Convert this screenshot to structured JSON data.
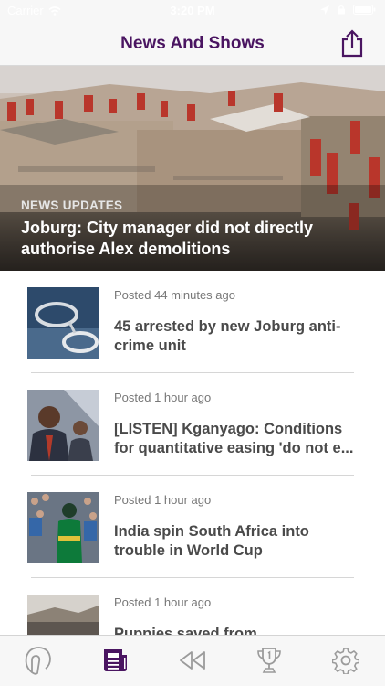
{
  "status_bar": {
    "carrier": "Carrier",
    "time": "3:20 PM"
  },
  "navbar": {
    "title": "News And Shows",
    "share_icon": "share-icon"
  },
  "hero": {
    "category": "NEWS UPDATES",
    "title": "Joburg: City manager did not directly authorise Alex demolitions"
  },
  "articles": [
    {
      "time": "Posted 44 minutes ago",
      "title_line1": "45 arrested by new Joburg anti-",
      "title_line2": "crime unit"
    },
    {
      "time": "Posted 1 hour ago",
      "title_line1": "[LISTEN] Kganyago: Conditions",
      "title_line2": "for quantitative easing 'do not e..."
    },
    {
      "time": "Posted 1 hour ago",
      "title_line1": "India spin South Africa into",
      "title_line2": "trouble in World Cup"
    },
    {
      "time": "Posted 1 hour ago",
      "title_line1": "Puppies saved from",
      "title_line2": ""
    }
  ],
  "tabbar": {
    "tabs": [
      {
        "icon": "listen-icon",
        "active": false
      },
      {
        "icon": "news-icon",
        "active": true
      },
      {
        "icon": "rewind-icon",
        "active": false
      },
      {
        "icon": "trophy-icon",
        "active": false
      },
      {
        "icon": "gear-icon",
        "active": false
      }
    ],
    "active_color": "#4a1561",
    "inactive_color": "#9b9b9b"
  },
  "colors": {
    "brand": "#4a1561",
    "text": "#4a4a4a",
    "muted": "#777777"
  }
}
